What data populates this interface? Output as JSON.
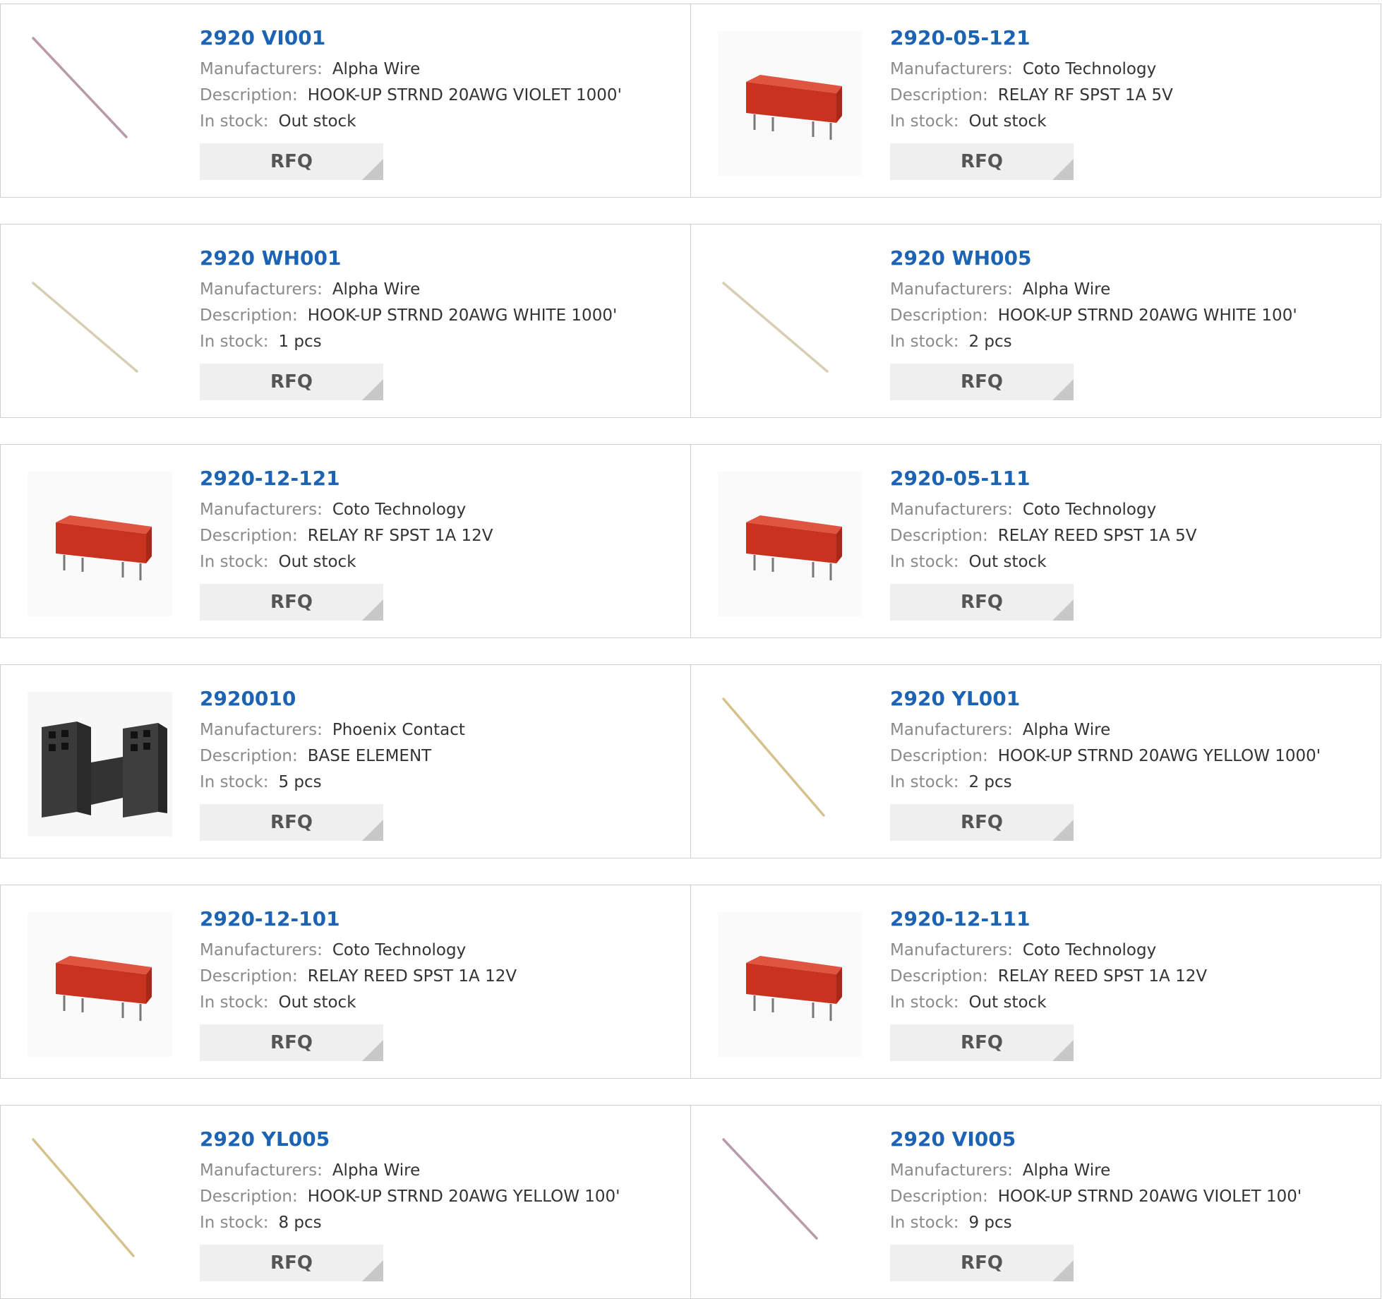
{
  "labels": {
    "manufacturers": "Manufacturers:",
    "description": "Description:",
    "in_stock": "In stock:",
    "rfq": "RFQ"
  },
  "products": [
    {
      "part": "2920 VI001",
      "manufacturer": "Alpha Wire",
      "description": "HOOK-UP STRND 20AWG VIOLET 1000'",
      "stock": "Out stock",
      "image": "violet-wire-image",
      "color": "#b89aa8"
    },
    {
      "part": "2920-05-121",
      "manufacturer": "Coto Technology",
      "description": "RELAY RF SPST 1A 5V",
      "stock": "Out stock",
      "image": "red-relay-image",
      "color": "#c8321f"
    },
    {
      "part": "2920 WH001",
      "manufacturer": "Alpha Wire",
      "description": "HOOK-UP STRND 20AWG WHITE 1000'",
      "stock": "1 pcs",
      "image": "white-wire-image",
      "color": "#d8ceb4"
    },
    {
      "part": "2920 WH005",
      "manufacturer": "Alpha Wire",
      "description": "HOOK-UP STRND 20AWG WHITE 100'",
      "stock": "2 pcs",
      "image": "white-wire-image",
      "color": "#d8ceb4"
    },
    {
      "part": "2920-12-121",
      "manufacturer": "Coto Technology",
      "description": "RELAY RF SPST 1A 12V",
      "stock": "Out stock",
      "image": "red-relay-image",
      "color": "#c8321f"
    },
    {
      "part": "2920-05-111",
      "manufacturer": "Coto Technology",
      "description": "RELAY REED SPST 1A 5V",
      "stock": "Out stock",
      "image": "red-relay-image",
      "color": "#c8321f"
    },
    {
      "part": "2920010",
      "manufacturer": "Phoenix Contact",
      "description": "BASE ELEMENT",
      "stock": "5 pcs",
      "image": "black-terminal-base-image",
      "color": "#3a3a3a"
    },
    {
      "part": "2920 YL001",
      "manufacturer": "Alpha Wire",
      "description": "HOOK-UP STRND 20AWG YELLOW 1000'",
      "stock": "2 pcs",
      "image": "yellow-wire-image",
      "color": "#d6c28c"
    },
    {
      "part": "2920-12-101",
      "manufacturer": "Coto Technology",
      "description": "RELAY REED SPST 1A 12V",
      "stock": "Out stock",
      "image": "red-relay-image",
      "color": "#c8321f"
    },
    {
      "part": "2920-12-111",
      "manufacturer": "Coto Technology",
      "description": "RELAY REED SPST 1A 12V",
      "stock": "Out stock",
      "image": "red-relay-image",
      "color": "#c8321f"
    },
    {
      "part": "2920 YL005",
      "manufacturer": "Alpha Wire",
      "description": "HOOK-UP STRND 20AWG YELLOW 100'",
      "stock": "8 pcs",
      "image": "yellow-wire-image",
      "color": "#d6c28c"
    },
    {
      "part": "2920 VI005",
      "manufacturer": "Alpha Wire",
      "description": "HOOK-UP STRND 20AWG VIOLET 100'",
      "stock": "9 pcs",
      "image": "violet-wire-image",
      "color": "#b89aa8"
    }
  ]
}
